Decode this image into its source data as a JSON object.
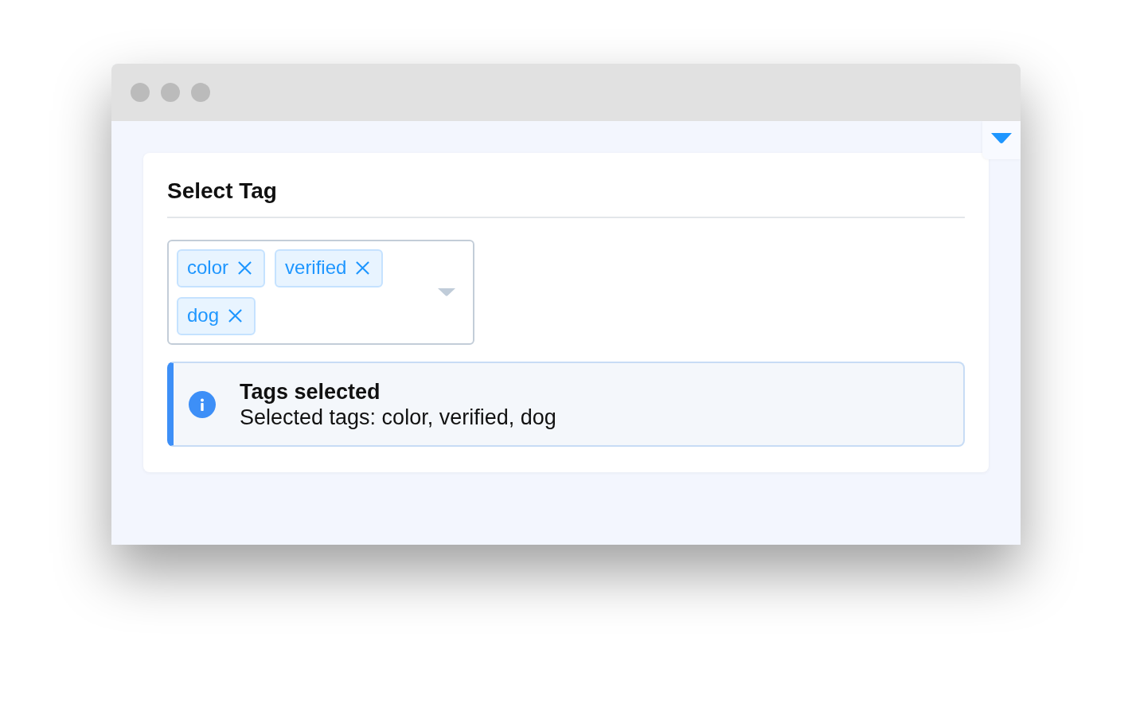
{
  "card": {
    "title": "Select Tag"
  },
  "tag_select": {
    "tags": [
      {
        "label": "color"
      },
      {
        "label": "verified"
      },
      {
        "label": "dog"
      }
    ]
  },
  "alert": {
    "kind": "info",
    "title": "Tags selected",
    "message": "Selected tags: color, verified, dog"
  }
}
